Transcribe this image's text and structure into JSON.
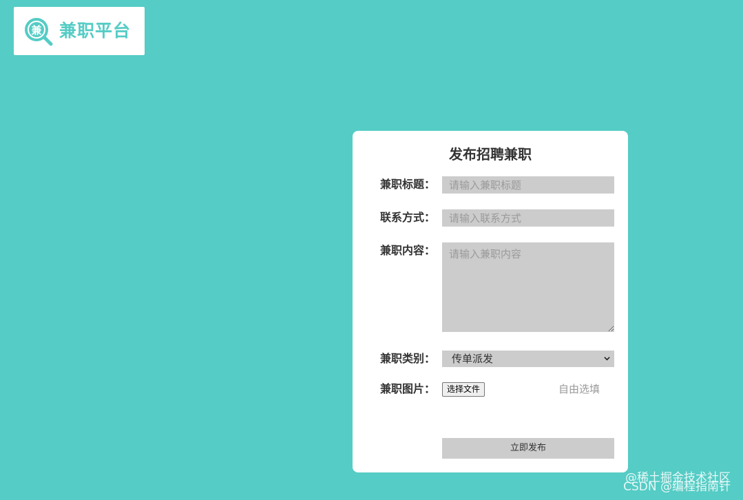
{
  "logo": {
    "icon_char": "兼",
    "text": "兼职平台",
    "icon": "magnifier-logo-icon"
  },
  "form": {
    "title": "发布招聘兼职",
    "title_field": {
      "label": "兼职标题：",
      "placeholder": "请输入兼职标题",
      "value": ""
    },
    "contact_field": {
      "label": "联系方式：",
      "placeholder": "请输入联系方式",
      "value": ""
    },
    "content_field": {
      "label": "兼职内容：",
      "placeholder": "请输入兼职内容",
      "value": ""
    },
    "category_field": {
      "label": "兼职类别：",
      "selected": "传单派发"
    },
    "image_field": {
      "label": "兼职图片：",
      "button": "选择文件",
      "hint": "自由选填"
    },
    "submit": "立即发布"
  },
  "watermark": {
    "line1": "@稀土掘金技术社区",
    "line2": "CSDN @编程指南针"
  },
  "colors": {
    "background": "#55ccc5",
    "card": "#ffffff",
    "field": "#cccccc"
  }
}
